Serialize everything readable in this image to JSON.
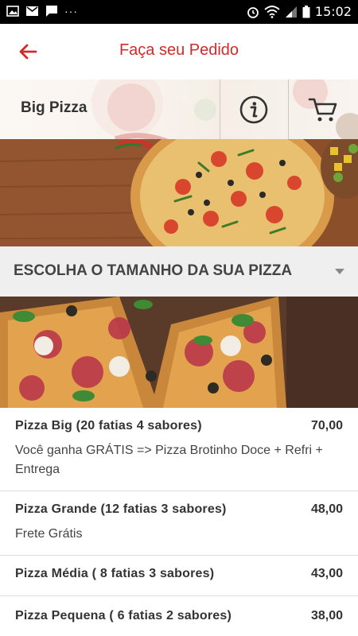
{
  "status_bar": {
    "time": "15:02",
    "dots": "···"
  },
  "app_bar": {
    "title": "Faça seu Pedido"
  },
  "store": {
    "name": "Big Pizza"
  },
  "size_selector": {
    "label": "ESCOLHA O TAMANHO DA SUA PIZZA"
  },
  "items": [
    {
      "name": "Pizza Big (20 fatias 4 sabores)",
      "price": "70,00",
      "description": "Você ganha GRÁTIS => Pizza Brotinho Doce + Refri + Entrega"
    },
    {
      "name": "Pizza Grande (12 fatias 3 sabores)",
      "price": "48,00",
      "description": "Frete Grátis"
    },
    {
      "name": "Pizza Média ( 8 fatias 3 sabores)",
      "price": "43,00",
      "description": ""
    },
    {
      "name": "Pizza Pequena ( 6 fatias 2 sabores)",
      "price": "38,00",
      "description": ""
    }
  ],
  "colors": {
    "accent": "#d32a2a",
    "status_bar": "#000000",
    "dropdown_bg": "#efefef"
  },
  "icons": {
    "back": "arrow-left-icon",
    "info": "info-icon",
    "cart": "cart-icon",
    "dropdown": "caret-down-icon"
  }
}
